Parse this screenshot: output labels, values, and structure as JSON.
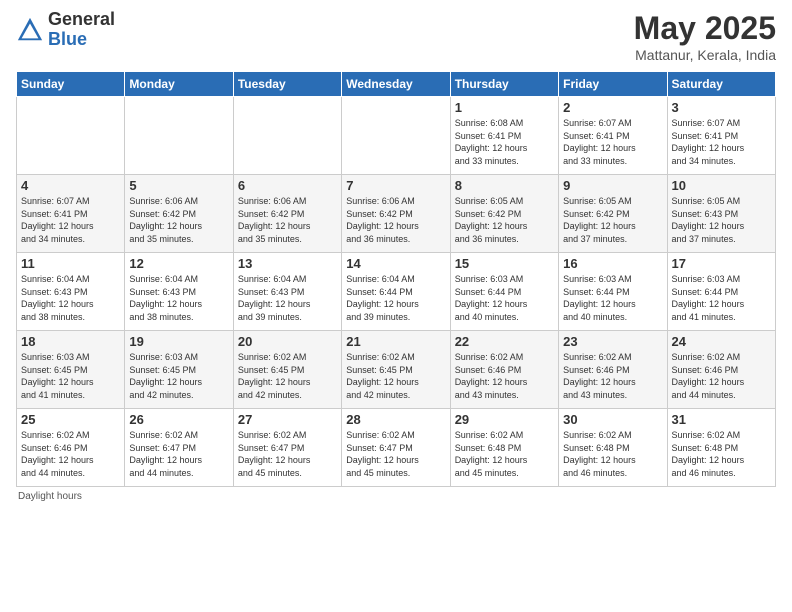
{
  "header": {
    "logo_general": "General",
    "logo_blue": "Blue",
    "title": "May 2025",
    "location": "Mattanur, Kerala, India"
  },
  "days_of_week": [
    "Sunday",
    "Monday",
    "Tuesday",
    "Wednesday",
    "Thursday",
    "Friday",
    "Saturday"
  ],
  "weeks": [
    [
      {
        "day": "",
        "detail": ""
      },
      {
        "day": "",
        "detail": ""
      },
      {
        "day": "",
        "detail": ""
      },
      {
        "day": "",
        "detail": ""
      },
      {
        "day": "1",
        "detail": "Sunrise: 6:08 AM\nSunset: 6:41 PM\nDaylight: 12 hours\nand 33 minutes."
      },
      {
        "day": "2",
        "detail": "Sunrise: 6:07 AM\nSunset: 6:41 PM\nDaylight: 12 hours\nand 33 minutes."
      },
      {
        "day": "3",
        "detail": "Sunrise: 6:07 AM\nSunset: 6:41 PM\nDaylight: 12 hours\nand 34 minutes."
      }
    ],
    [
      {
        "day": "4",
        "detail": "Sunrise: 6:07 AM\nSunset: 6:41 PM\nDaylight: 12 hours\nand 34 minutes."
      },
      {
        "day": "5",
        "detail": "Sunrise: 6:06 AM\nSunset: 6:42 PM\nDaylight: 12 hours\nand 35 minutes."
      },
      {
        "day": "6",
        "detail": "Sunrise: 6:06 AM\nSunset: 6:42 PM\nDaylight: 12 hours\nand 35 minutes."
      },
      {
        "day": "7",
        "detail": "Sunrise: 6:06 AM\nSunset: 6:42 PM\nDaylight: 12 hours\nand 36 minutes."
      },
      {
        "day": "8",
        "detail": "Sunrise: 6:05 AM\nSunset: 6:42 PM\nDaylight: 12 hours\nand 36 minutes."
      },
      {
        "day": "9",
        "detail": "Sunrise: 6:05 AM\nSunset: 6:42 PM\nDaylight: 12 hours\nand 37 minutes."
      },
      {
        "day": "10",
        "detail": "Sunrise: 6:05 AM\nSunset: 6:43 PM\nDaylight: 12 hours\nand 37 minutes."
      }
    ],
    [
      {
        "day": "11",
        "detail": "Sunrise: 6:04 AM\nSunset: 6:43 PM\nDaylight: 12 hours\nand 38 minutes."
      },
      {
        "day": "12",
        "detail": "Sunrise: 6:04 AM\nSunset: 6:43 PM\nDaylight: 12 hours\nand 38 minutes."
      },
      {
        "day": "13",
        "detail": "Sunrise: 6:04 AM\nSunset: 6:43 PM\nDaylight: 12 hours\nand 39 minutes."
      },
      {
        "day": "14",
        "detail": "Sunrise: 6:04 AM\nSunset: 6:44 PM\nDaylight: 12 hours\nand 39 minutes."
      },
      {
        "day": "15",
        "detail": "Sunrise: 6:03 AM\nSunset: 6:44 PM\nDaylight: 12 hours\nand 40 minutes."
      },
      {
        "day": "16",
        "detail": "Sunrise: 6:03 AM\nSunset: 6:44 PM\nDaylight: 12 hours\nand 40 minutes."
      },
      {
        "day": "17",
        "detail": "Sunrise: 6:03 AM\nSunset: 6:44 PM\nDaylight: 12 hours\nand 41 minutes."
      }
    ],
    [
      {
        "day": "18",
        "detail": "Sunrise: 6:03 AM\nSunset: 6:45 PM\nDaylight: 12 hours\nand 41 minutes."
      },
      {
        "day": "19",
        "detail": "Sunrise: 6:03 AM\nSunset: 6:45 PM\nDaylight: 12 hours\nand 42 minutes."
      },
      {
        "day": "20",
        "detail": "Sunrise: 6:02 AM\nSunset: 6:45 PM\nDaylight: 12 hours\nand 42 minutes."
      },
      {
        "day": "21",
        "detail": "Sunrise: 6:02 AM\nSunset: 6:45 PM\nDaylight: 12 hours\nand 42 minutes."
      },
      {
        "day": "22",
        "detail": "Sunrise: 6:02 AM\nSunset: 6:46 PM\nDaylight: 12 hours\nand 43 minutes."
      },
      {
        "day": "23",
        "detail": "Sunrise: 6:02 AM\nSunset: 6:46 PM\nDaylight: 12 hours\nand 43 minutes."
      },
      {
        "day": "24",
        "detail": "Sunrise: 6:02 AM\nSunset: 6:46 PM\nDaylight: 12 hours\nand 44 minutes."
      }
    ],
    [
      {
        "day": "25",
        "detail": "Sunrise: 6:02 AM\nSunset: 6:46 PM\nDaylight: 12 hours\nand 44 minutes."
      },
      {
        "day": "26",
        "detail": "Sunrise: 6:02 AM\nSunset: 6:47 PM\nDaylight: 12 hours\nand 44 minutes."
      },
      {
        "day": "27",
        "detail": "Sunrise: 6:02 AM\nSunset: 6:47 PM\nDaylight: 12 hours\nand 45 minutes."
      },
      {
        "day": "28",
        "detail": "Sunrise: 6:02 AM\nSunset: 6:47 PM\nDaylight: 12 hours\nand 45 minutes."
      },
      {
        "day": "29",
        "detail": "Sunrise: 6:02 AM\nSunset: 6:48 PM\nDaylight: 12 hours\nand 45 minutes."
      },
      {
        "day": "30",
        "detail": "Sunrise: 6:02 AM\nSunset: 6:48 PM\nDaylight: 12 hours\nand 46 minutes."
      },
      {
        "day": "31",
        "detail": "Sunrise: 6:02 AM\nSunset: 6:48 PM\nDaylight: 12 hours\nand 46 minutes."
      }
    ]
  ],
  "footer": "Daylight hours"
}
